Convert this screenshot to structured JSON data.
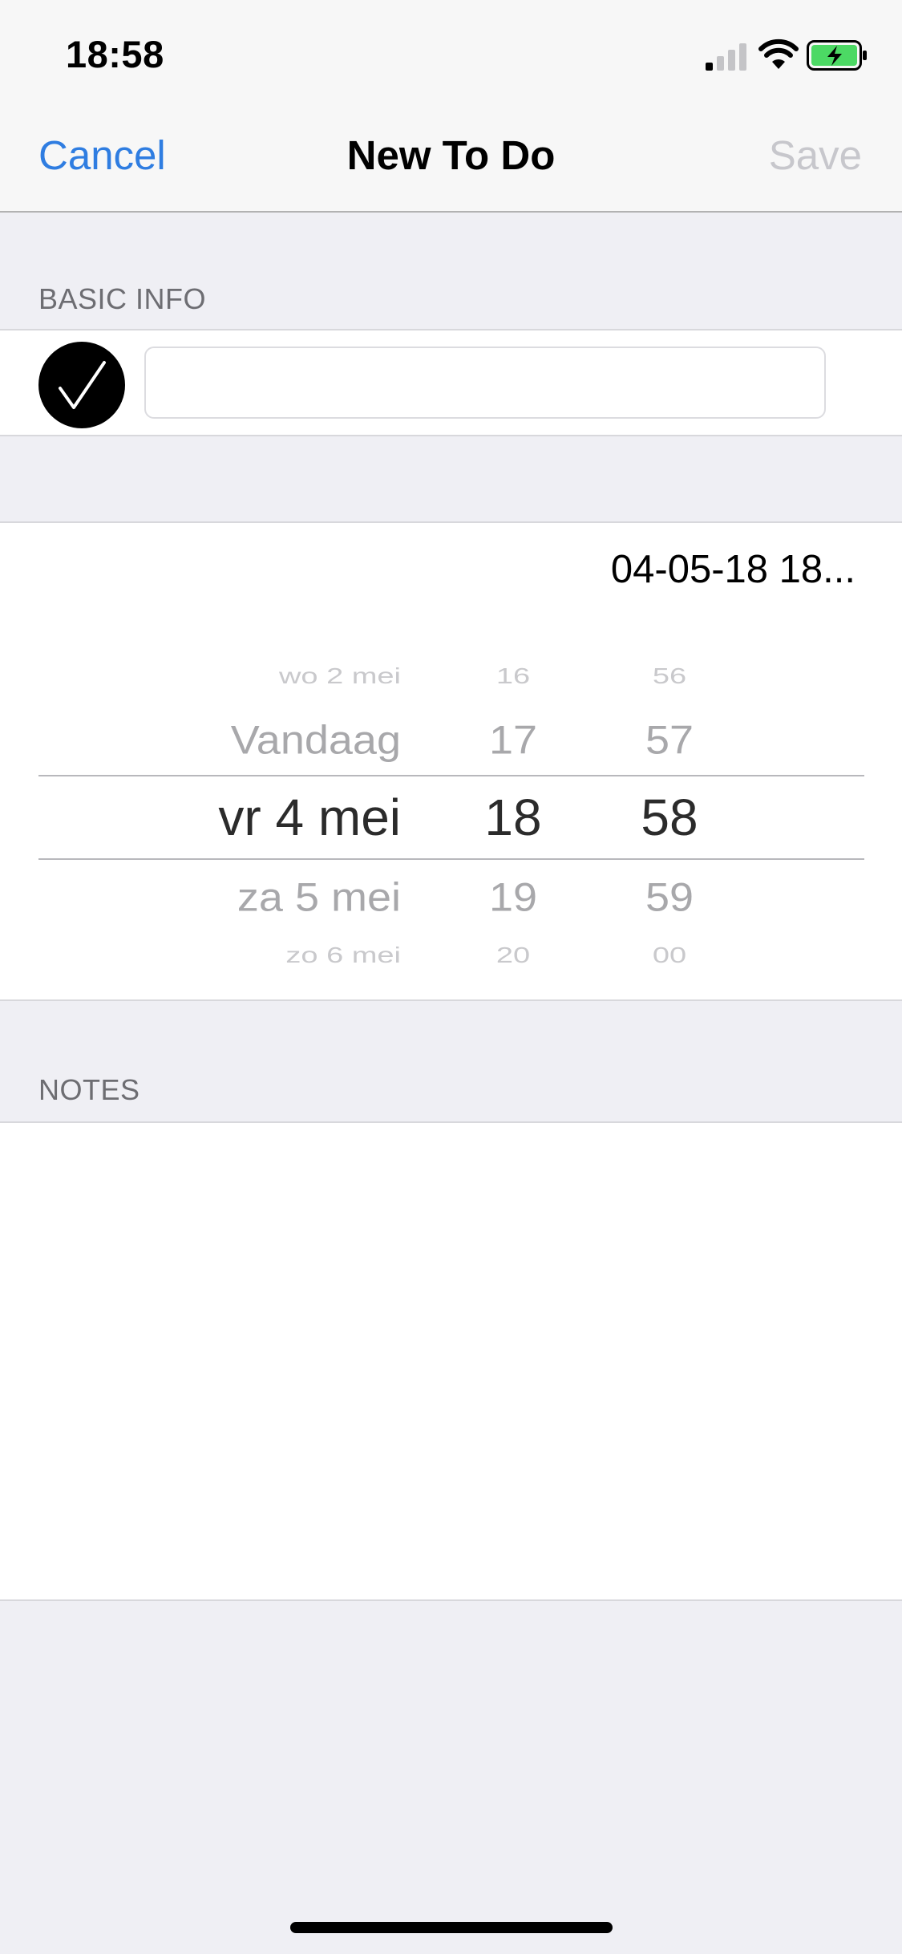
{
  "status_bar": {
    "time": "18:58",
    "icons": [
      "signal-icon",
      "wifi-icon",
      "battery-charging-icon"
    ],
    "battery_color": "#4cd964"
  },
  "nav": {
    "cancel_label": "Cancel",
    "title": "New To Do",
    "save_label": "Save",
    "accent_color": "#2f7de1",
    "save_disabled": true
  },
  "basic_info": {
    "header": "BASIC INFO",
    "completed_icon": "checkmark-icon",
    "title_value": "",
    "title_placeholder": ""
  },
  "date": {
    "display_value": "04-05-18 18...",
    "picker": {
      "days": [
        "wo 2 mei",
        "Vandaag",
        "vr 4 mei",
        "za 5 mei",
        "zo 6 mei"
      ],
      "hours": [
        "16",
        "17",
        "18",
        "19",
        "20"
      ],
      "minutes": [
        "56",
        "57",
        "58",
        "59",
        "00"
      ],
      "selected": {
        "day": "vr 4 mei",
        "hour": "18",
        "minute": "58"
      }
    }
  },
  "notes": {
    "header": "NOTES",
    "value": ""
  }
}
